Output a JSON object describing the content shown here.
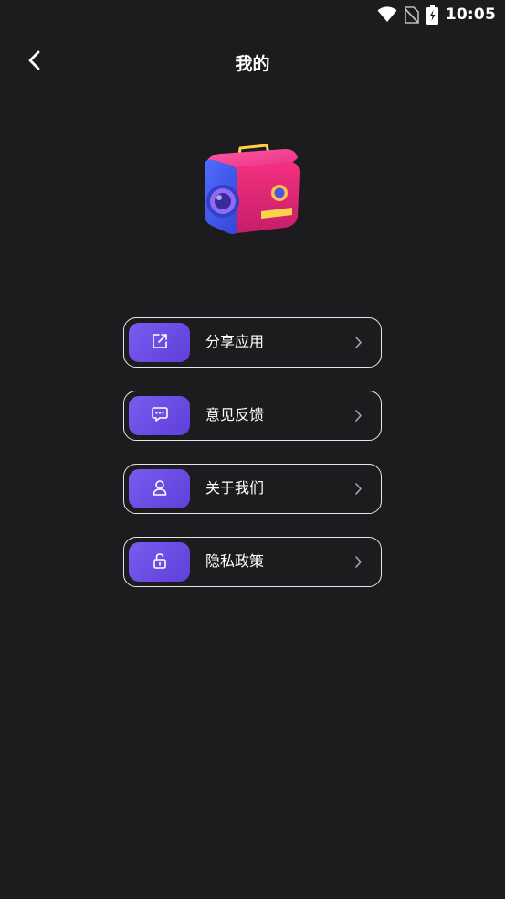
{
  "status_bar": {
    "time": "10:05",
    "icons": [
      "wifi-icon",
      "no-sim-icon",
      "battery-charging-icon"
    ]
  },
  "header": {
    "title": "我的",
    "back_icon": "chevron-left-icon"
  },
  "hero": {
    "icon": "camera-illustration"
  },
  "menu": {
    "items": [
      {
        "label": "分享应用",
        "icon": "share-icon"
      },
      {
        "label": "意见反馈",
        "icon": "feedback-icon"
      },
      {
        "label": "关于我们",
        "icon": "user-icon"
      },
      {
        "label": "隐私政策",
        "icon": "lock-icon"
      }
    ]
  },
  "colors": {
    "background": "#1c1b1d",
    "accent": "#6a4ce4",
    "border": "#e6e6ea",
    "text": "#ffffff"
  }
}
